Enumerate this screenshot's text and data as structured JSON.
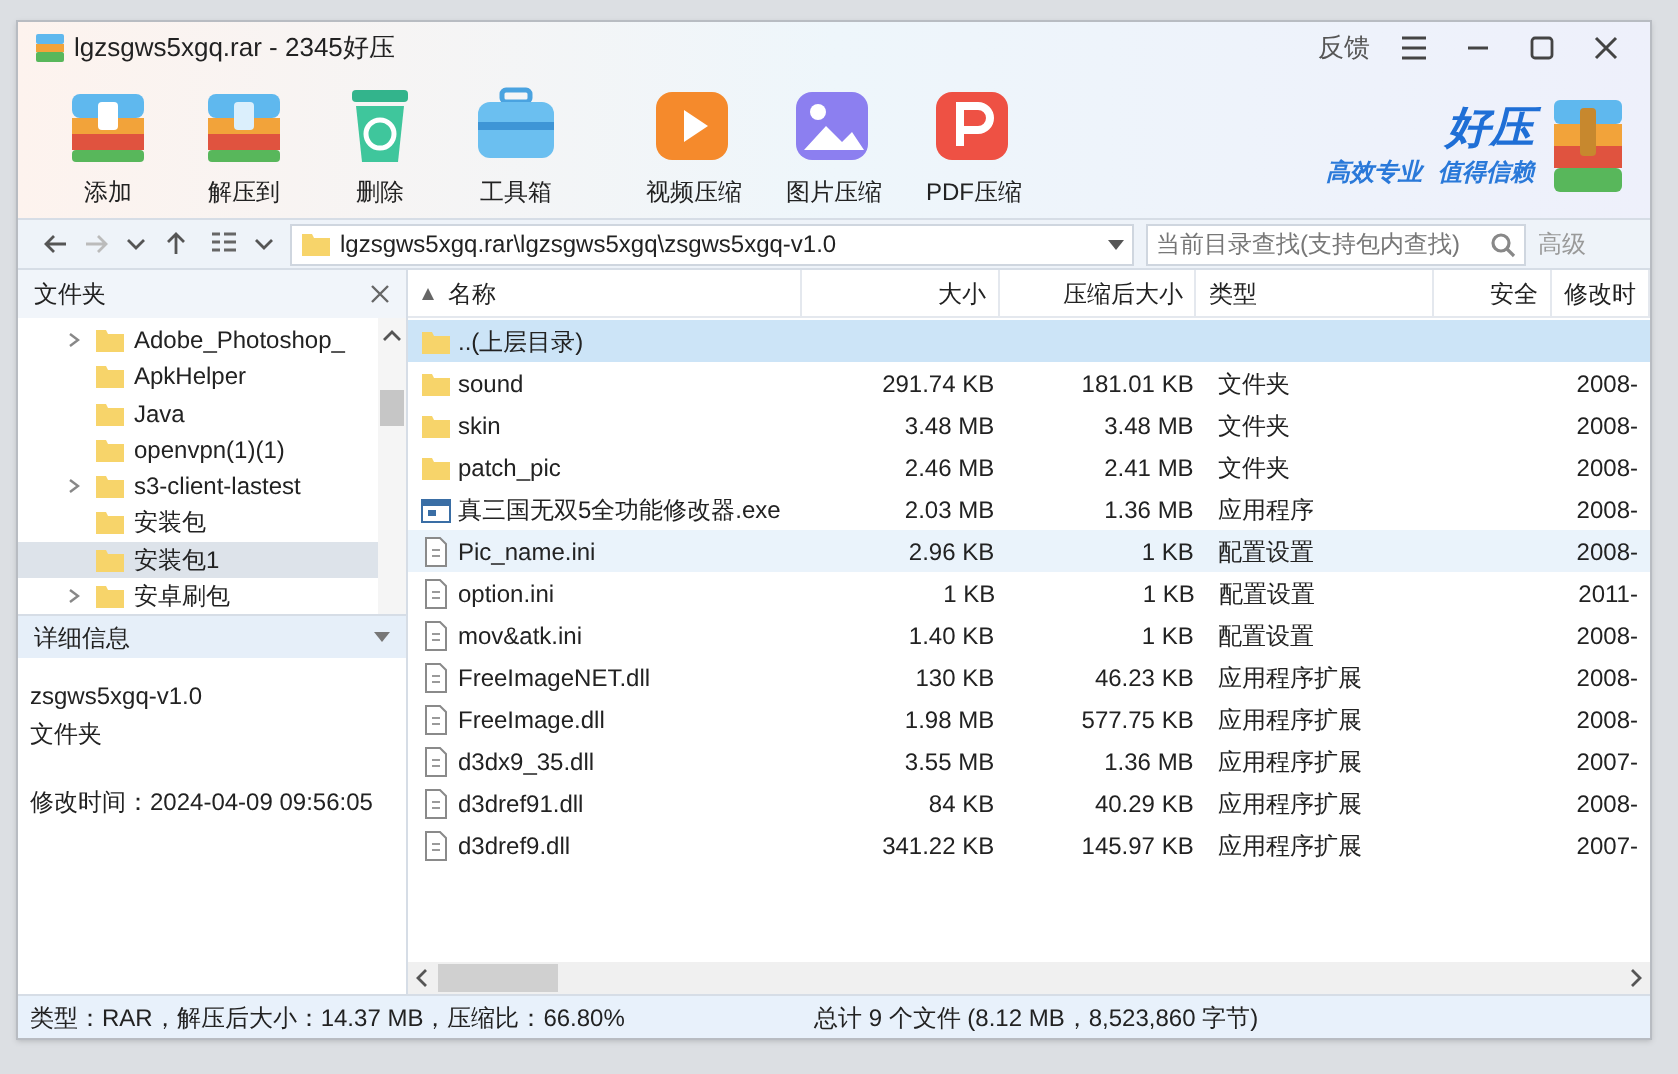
{
  "window": {
    "title": "lgzsgws5xgq.rar - 2345好压",
    "feedback": "反馈"
  },
  "toolbar": {
    "archive_tools": [
      {
        "label": "添加",
        "kind": "add"
      },
      {
        "label": "解压到",
        "kind": "extract"
      },
      {
        "label": "删除",
        "kind": "delete"
      },
      {
        "label": "工具箱",
        "kind": "toolbox"
      }
    ],
    "media_tools": [
      {
        "label": "视频压缩",
        "kind": "video"
      },
      {
        "label": "图片压缩",
        "kind": "image"
      },
      {
        "label": "PDF压缩",
        "kind": "pdf"
      }
    ]
  },
  "brand": {
    "name": "好压",
    "slogan_1": "高效专业",
    "slogan_2": "值得信赖"
  },
  "navigation": {
    "forward_disabled": true,
    "path": "lgzsgws5xgq.rar\\lgzsgws5xgq\\zsgws5xgq-v1.0",
    "search": {
      "placeholder": "当前目录查找(支持包内查找)"
    },
    "advanced": "高级"
  },
  "folder_tree": {
    "title": "文件夹",
    "items": [
      {
        "label": "Adobe_Photoshop_",
        "expandable": true,
        "selected": false
      },
      {
        "label": "ApkHelper",
        "expandable": false,
        "selected": false
      },
      {
        "label": "Java",
        "expandable": false,
        "selected": false
      },
      {
        "label": "openvpn(1)(1)",
        "expandable": false,
        "selected": false
      },
      {
        "label": "s3-client-lastest",
        "expandable": true,
        "selected": false
      },
      {
        "label": "安装包",
        "expandable": false,
        "selected": false
      },
      {
        "label": "安装包1",
        "expandable": false,
        "selected": true
      },
      {
        "label": "安卓刷包",
        "expandable": true,
        "selected": false
      }
    ]
  },
  "details": {
    "title": "详细信息",
    "name": "zsgws5xgq-v1.0",
    "type": "文件夹",
    "modified": "修改时间：2024-04-09 09:56:05"
  },
  "table": {
    "columns": [
      "名称",
      "大小",
      "压缩后大小",
      "类型",
      "安全",
      "修改时"
    ],
    "rows": [
      {
        "kind": "folder",
        "name": "..(上层目录)",
        "selected": true,
        "hovered": false
      },
      {
        "kind": "folder",
        "name": "sound",
        "size": "291.74 KB",
        "packed": "181.01 KB",
        "type": "文件夹",
        "modified": "2008-",
        "selected": false,
        "hovered": false
      },
      {
        "kind": "folder",
        "name": "skin",
        "size": "3.48 MB",
        "packed": "3.48 MB",
        "type": "文件夹",
        "modified": "2008-",
        "selected": false,
        "hovered": false
      },
      {
        "kind": "folder",
        "name": "patch_pic",
        "size": "2.46 MB",
        "packed": "2.41 MB",
        "type": "文件夹",
        "modified": "2008-",
        "selected": false,
        "hovered": false
      },
      {
        "kind": "exe",
        "name": "真三国无双5全功能修改器.exe",
        "size": "2.03 MB",
        "packed": "1.36 MB",
        "type": "应用程序",
        "modified": "2008-",
        "selected": false,
        "hovered": false
      },
      {
        "kind": "file",
        "name": "Pic_name.ini",
        "size": "2.96 KB",
        "packed": "1 KB",
        "type": "配置设置",
        "modified": "2008-",
        "selected": false,
        "hovered": true
      },
      {
        "kind": "file",
        "name": "option.ini",
        "size": "1 KB",
        "packed": "1 KB",
        "type": "配置设置",
        "modified": "2011-",
        "selected": false,
        "hovered": false
      },
      {
        "kind": "file",
        "name": "mov&atk.ini",
        "size": "1.40 KB",
        "packed": "1 KB",
        "type": "配置设置",
        "modified": "2008-",
        "selected": false,
        "hovered": false
      },
      {
        "kind": "file",
        "name": "FreeImageNET.dll",
        "size": "130 KB",
        "packed": "46.23 KB",
        "type": "应用程序扩展",
        "modified": "2008-",
        "selected": false,
        "hovered": false
      },
      {
        "kind": "file",
        "name": "FreeImage.dll",
        "size": "1.98 MB",
        "packed": "577.75 KB",
        "type": "应用程序扩展",
        "modified": "2008-",
        "selected": false,
        "hovered": false
      },
      {
        "kind": "file",
        "name": "d3dx9_35.dll",
        "size": "3.55 MB",
        "packed": "1.36 MB",
        "type": "应用程序扩展",
        "modified": "2007-",
        "selected": false,
        "hovered": false
      },
      {
        "kind": "file",
        "name": "d3dref91.dll",
        "size": "84 KB",
        "packed": "40.29 KB",
        "type": "应用程序扩展",
        "modified": "2008-",
        "selected": false,
        "hovered": false
      },
      {
        "kind": "file",
        "name": "d3dref9.dll",
        "size": "341.22 KB",
        "packed": "145.97 KB",
        "type": "应用程序扩展",
        "modified": "2007-",
        "selected": false,
        "hovered": false
      }
    ]
  },
  "status_bar": {
    "summary": "类型：RAR，解压后大小：14.37 MB，压缩比：66.80%",
    "totals": "总计 9 个文件 (8.12 MB，8,523,860 字节)"
  }
}
